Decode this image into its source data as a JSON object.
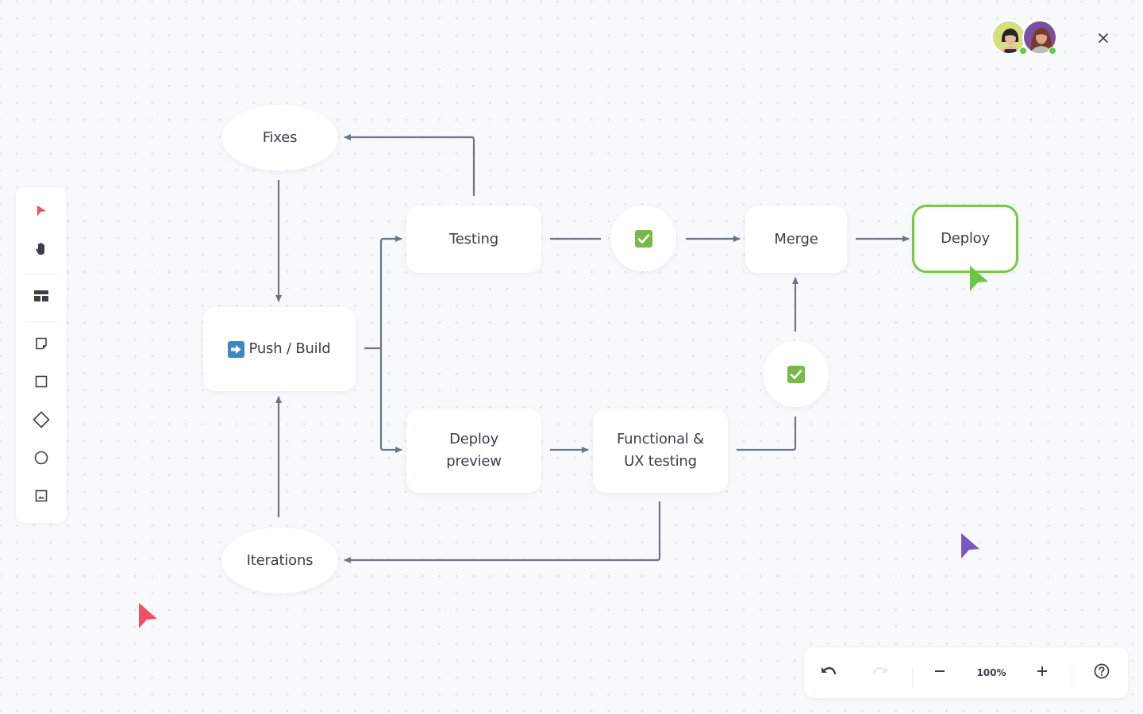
{
  "diagram": {
    "nodes": {
      "fixes": "Fixes",
      "push_build": "Push / Build",
      "iterations": "Iterations",
      "testing": "Testing",
      "deploy_preview_line1": "Deploy",
      "deploy_preview_line2": "preview",
      "functional_line1": "Functional &",
      "functional_line2": "UX testing",
      "merge": "Merge",
      "deploy": "Deploy",
      "check_top": "check-passed",
      "check_right": "check-passed"
    },
    "edges": [
      {
        "from": "testing",
        "to": "fixes"
      },
      {
        "from": "fixes",
        "to": "push_build"
      },
      {
        "from": "iterations",
        "to": "push_build"
      },
      {
        "from": "push_build",
        "to": "testing"
      },
      {
        "from": "push_build",
        "to": "deploy_preview"
      },
      {
        "from": "testing",
        "to": "check_top"
      },
      {
        "from": "check_top",
        "to": "merge"
      },
      {
        "from": "merge",
        "to": "deploy"
      },
      {
        "from": "deploy_preview",
        "to": "functional"
      },
      {
        "from": "functional",
        "to": "check_right"
      },
      {
        "from": "check_right",
        "to": "merge"
      },
      {
        "from": "functional",
        "to": "iterations"
      }
    ],
    "selected_node": "deploy",
    "colors": {
      "edge": "#6b7682",
      "selected_border": "#7ac943",
      "check": "#78b94c",
      "push_icon": "#3b88c3"
    }
  },
  "toolbar": {
    "tools": [
      {
        "name": "select",
        "icon": "pointer-icon",
        "active": true
      },
      {
        "name": "hand",
        "icon": "hand-icon"
      },
      {
        "name": "table",
        "icon": "table-icon"
      },
      {
        "name": "sticky-note",
        "icon": "sticky-note-icon"
      },
      {
        "name": "rectangle",
        "icon": "square-icon"
      },
      {
        "name": "diamond",
        "icon": "diamond-icon"
      },
      {
        "name": "circle",
        "icon": "circle-icon"
      },
      {
        "name": "image",
        "icon": "image-icon"
      }
    ]
  },
  "bottom_bar": {
    "undo": "undo-icon",
    "redo": "redo-icon",
    "zoom_out": "minus-icon",
    "zoom_level": "100%",
    "zoom_in": "plus-icon",
    "help": "help-icon"
  },
  "collaborators": [
    {
      "avatar_bg": "#d5e07f",
      "online": true
    },
    {
      "avatar_bg": "#7a4fa0",
      "online": true
    }
  ],
  "cursors": [
    {
      "color": "#f0505f"
    },
    {
      "color": "#7c55c4"
    },
    {
      "color": "#6cc644"
    }
  ]
}
